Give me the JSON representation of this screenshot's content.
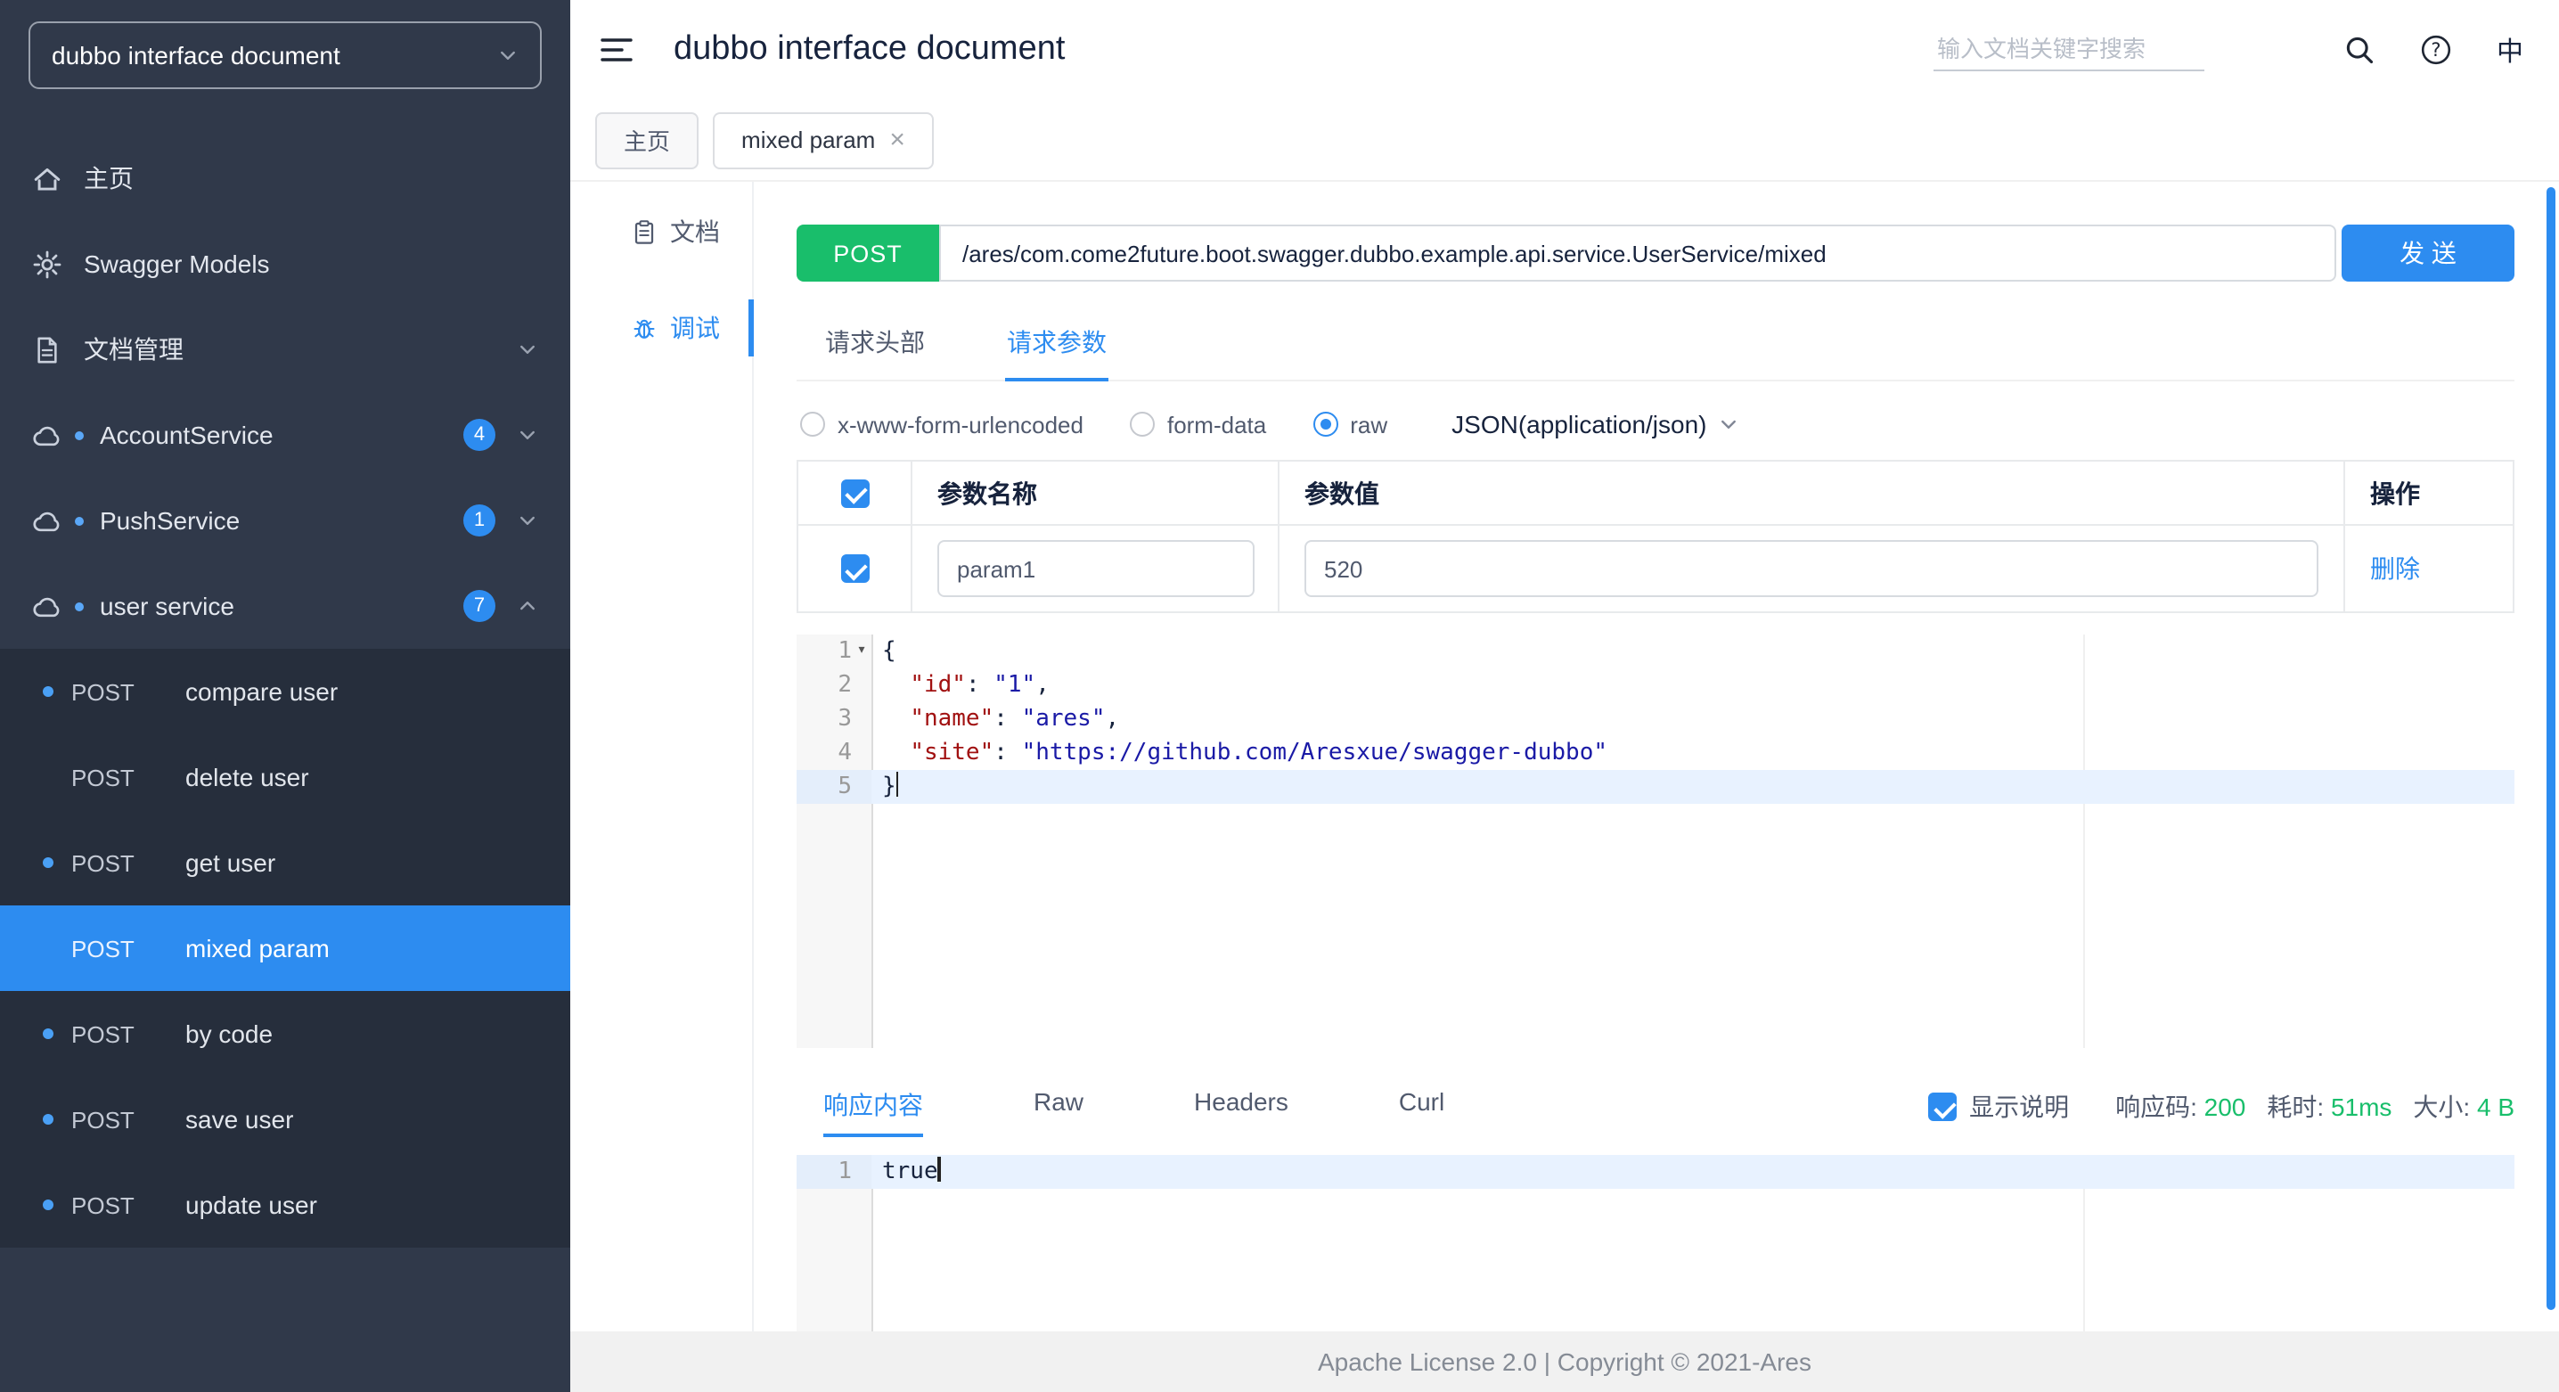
{
  "header": {
    "title": "dubbo interface document",
    "search_placeholder": "输入文档关键字搜索",
    "lang_label": "中"
  },
  "sidebar": {
    "selector_value": "dubbo interface document",
    "items": [
      {
        "id": "home",
        "icon": "home",
        "label": "主页"
      },
      {
        "id": "swagger-models",
        "icon": "gear",
        "label": "Swagger Models"
      },
      {
        "id": "doc-management",
        "icon": "file",
        "label": "文档管理",
        "chevron": "down"
      },
      {
        "id": "account-service",
        "icon": "cloud",
        "dot": true,
        "label": "AccountService",
        "badge": "4",
        "chevron": "down"
      },
      {
        "id": "push-service",
        "icon": "cloud",
        "dot": true,
        "label": "PushService",
        "badge": "1",
        "chevron": "down"
      },
      {
        "id": "user-service",
        "icon": "cloud",
        "dot": true,
        "label": "user service",
        "badge": "7",
        "chevron": "up",
        "expanded": true
      }
    ],
    "operations": [
      {
        "id": "compare-user",
        "method": "POST",
        "label": "compare user",
        "dot": true
      },
      {
        "id": "delete-user",
        "method": "POST",
        "label": "delete user",
        "dot": false
      },
      {
        "id": "get-user",
        "method": "POST",
        "label": "get user",
        "dot": true
      },
      {
        "id": "mixed-param",
        "method": "POST",
        "label": "mixed param",
        "dot": false,
        "active": true
      },
      {
        "id": "by-code",
        "method": "POST",
        "label": "by code",
        "dot": true
      },
      {
        "id": "save-user",
        "method": "POST",
        "label": "save user",
        "dot": true
      },
      {
        "id": "update-user",
        "method": "POST",
        "label": "update user",
        "dot": true
      }
    ]
  },
  "tabs": [
    {
      "id": "home",
      "label": "主页",
      "closable": false,
      "active": false
    },
    {
      "id": "mixed-param",
      "label": "mixed param",
      "closable": true,
      "active": true
    }
  ],
  "subnav": [
    {
      "id": "doc",
      "icon": "clipboard",
      "label": "文档",
      "active": false
    },
    {
      "id": "debug",
      "icon": "debug",
      "label": "调试",
      "active": true
    }
  ],
  "request": {
    "method": "POST",
    "url": "/ares/com.come2future.boot.swagger.dubbo.example.api.service.UserService/mixed",
    "send_label": "发 送",
    "tabs": [
      {
        "id": "headers",
        "label": "请求头部",
        "active": false
      },
      {
        "id": "params",
        "label": "请求参数",
        "active": true
      }
    ],
    "body_types": [
      {
        "id": "urlencoded",
        "label": "x-www-form-urlencoded",
        "checked": false
      },
      {
        "id": "form-data",
        "label": "form-data",
        "checked": false
      },
      {
        "id": "raw",
        "label": "raw",
        "checked": true
      }
    ],
    "raw_content_type": "JSON(application/json)",
    "params_table": {
      "check_all": true,
      "columns": [
        "参数名称",
        "参数值",
        "操作"
      ],
      "rows": [
        {
          "checked": true,
          "name": "param1",
          "value": "520",
          "action": "删除"
        }
      ]
    },
    "editor": {
      "lines": [
        {
          "num": "1",
          "fold": true,
          "tokens": [
            {
              "text": "{"
            }
          ]
        },
        {
          "num": "2",
          "tokens": [
            {
              "text": "  "
            },
            {
              "text": "\"id\"",
              "type": "key"
            },
            {
              "text": ": "
            },
            {
              "text": "\"1\"",
              "type": "str"
            },
            {
              "text": ","
            }
          ]
        },
        {
          "num": "3",
          "tokens": [
            {
              "text": "  "
            },
            {
              "text": "\"name\"",
              "type": "key"
            },
            {
              "text": ": "
            },
            {
              "text": "\"ares\"",
              "type": "str"
            },
            {
              "text": ","
            }
          ]
        },
        {
          "num": "4",
          "tokens": [
            {
              "text": "  "
            },
            {
              "text": "\"site\"",
              "type": "key"
            },
            {
              "text": ": "
            },
            {
              "text": "\"https://github.com/Aresxue/swagger-dubbo\"",
              "type": "str"
            }
          ]
        },
        {
          "num": "5",
          "active": true,
          "cursor": true,
          "tokens": [
            {
              "text": "}"
            }
          ]
        }
      ]
    }
  },
  "response": {
    "tabs": [
      {
        "id": "content",
        "label": "响应内容",
        "active": true
      },
      {
        "id": "raw",
        "label": "Raw",
        "active": false
      },
      {
        "id": "headers",
        "label": "Headers",
        "active": false
      },
      {
        "id": "curl",
        "label": "Curl",
        "active": false
      }
    ],
    "show_desc": {
      "label": "显示说明",
      "checked": true
    },
    "meta": [
      {
        "id": "status-code",
        "label": "响应码:",
        "value": "200"
      },
      {
        "id": "time",
        "label": "耗时:",
        "value": "51ms"
      },
      {
        "id": "size",
        "label": "大小:",
        "value": "4 B"
      }
    ],
    "editor": {
      "lines": [
        {
          "num": "1",
          "active": true,
          "cursor": true,
          "tokens": [
            {
              "text": "true"
            }
          ]
        }
      ]
    }
  },
  "footer": {
    "text": "Apache License 2.0 | Copyright © 2021-Ares"
  },
  "colors": {
    "primary": "#2d8cf0",
    "success": "#19be6b",
    "sidebar_bg": "#30394a",
    "sidebar_sub_bg": "#262e3c",
    "editor_key": "#a11111",
    "editor_string": "#1a1aa6",
    "active_line_bg": "#e8f2ff"
  }
}
